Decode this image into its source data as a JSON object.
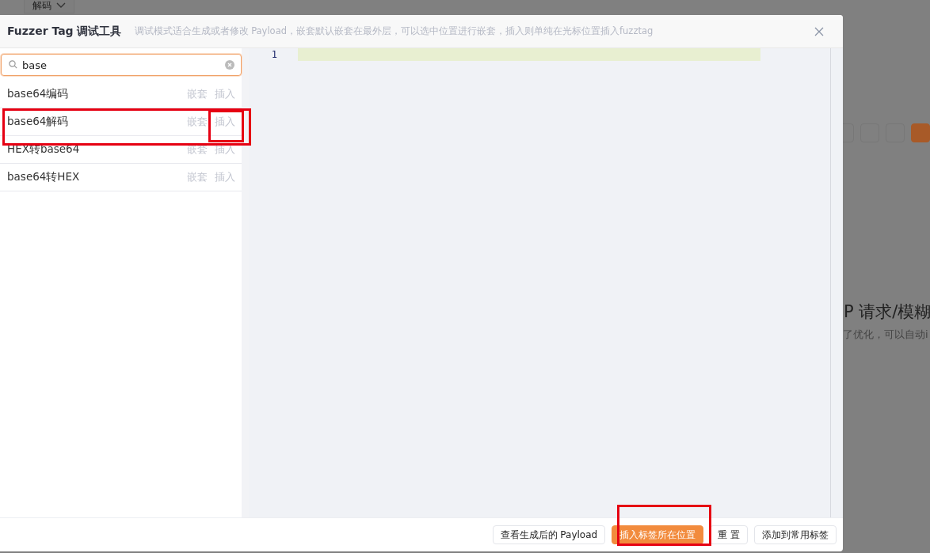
{
  "background": {
    "tab": {
      "label": "解码"
    },
    "heading": "P 请求/模糊",
    "subtext": "了优化，可以自动i"
  },
  "dialog": {
    "title": "Fuzzer Tag 调试工具",
    "hint": "调试模式适合生成或者修改 Payload，嵌套默认嵌套在最外层，可以选中位置进行嵌套，插入则单纯在光标位置插入fuzztag"
  },
  "search": {
    "value": "base"
  },
  "tags": [
    {
      "name": "base64编码",
      "actions": [
        "嵌套",
        "插入"
      ]
    },
    {
      "name": "base64解码",
      "actions": [
        "嵌套",
        "插入"
      ]
    },
    {
      "name": "HEX转base64",
      "actions": [
        "嵌套",
        "插入"
      ]
    },
    {
      "name": "base64转HEX",
      "actions": [
        "嵌套",
        "插入"
      ]
    }
  ],
  "editor": {
    "line_numbers": [
      "1"
    ]
  },
  "buttons": [
    {
      "label": "查看生成后的 Payload",
      "kind": "default"
    },
    {
      "label": "插入标签所在位置",
      "kind": "primary"
    },
    {
      "label": "重 置",
      "kind": "default"
    },
    {
      "label": "添加到常用标签",
      "kind": "default"
    }
  ]
}
